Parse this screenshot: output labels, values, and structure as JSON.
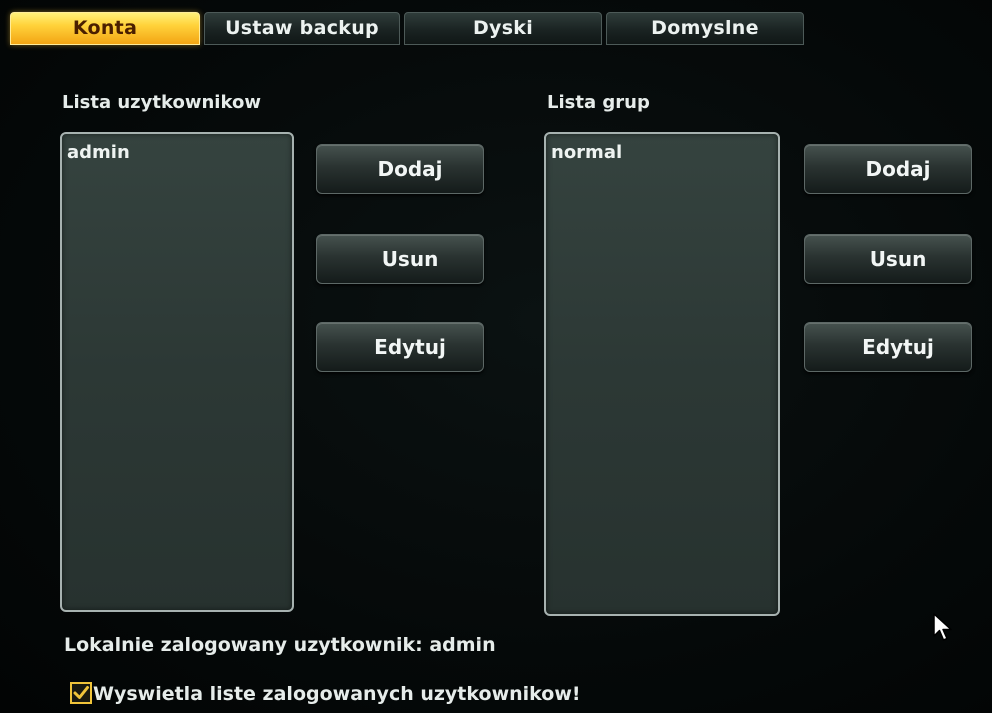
{
  "tabs": [
    {
      "label": "Konta",
      "active": true
    },
    {
      "label": "Ustaw backup",
      "active": false
    },
    {
      "label": "Dyski",
      "active": false
    },
    {
      "label": "Domyslne",
      "active": false
    }
  ],
  "users": {
    "heading": "Lista uzytkownikow",
    "items": [
      "admin"
    ],
    "buttons": {
      "add": "Dodaj",
      "remove": "Usun",
      "edit": "Edytuj"
    }
  },
  "groups": {
    "heading": "Lista grup",
    "items": [
      "normal"
    ],
    "buttons": {
      "add": "Dodaj",
      "remove": "Usun",
      "edit": "Edytuj"
    }
  },
  "status": {
    "logged_in_user": "Lokalnie zalogowany uzytkownik: admin"
  },
  "show_logged_users": {
    "label": "Wyswietla liste zalogowanych uzytkownikow!",
    "checked": true
  },
  "colors": {
    "active_tab": "#ffd23a",
    "checkbox": "#f0c43a"
  }
}
